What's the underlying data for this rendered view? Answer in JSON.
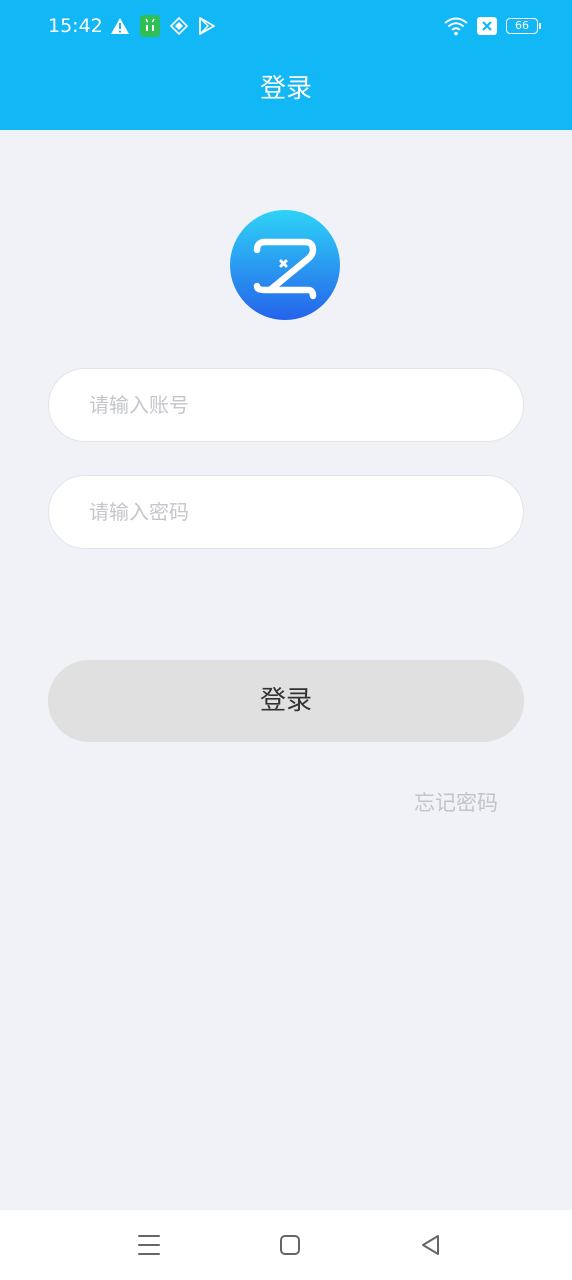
{
  "status_bar": {
    "time": "15:42",
    "left_icons": [
      "warning-icon",
      "android-app-icon",
      "diamond-app-icon",
      "play-store-icon"
    ],
    "right_icons": [
      "wifi-icon",
      "sim-x-icon",
      "battery-icon"
    ],
    "battery_level": "66"
  },
  "header": {
    "title": "登录",
    "background_color": "#12b7f5"
  },
  "logo": {
    "icon": "z-logo-icon",
    "gradient_top": "#2fd3f7",
    "gradient_bottom": "#2563eb"
  },
  "form": {
    "account_placeholder": "请输入账号",
    "account_value": "",
    "password_placeholder": "请输入密码",
    "password_value": "",
    "login_label": "登录",
    "forgot_password_label": "忘记密码"
  },
  "nav_bar": {
    "icons": [
      "menu-icon",
      "home-icon",
      "back-icon"
    ]
  }
}
